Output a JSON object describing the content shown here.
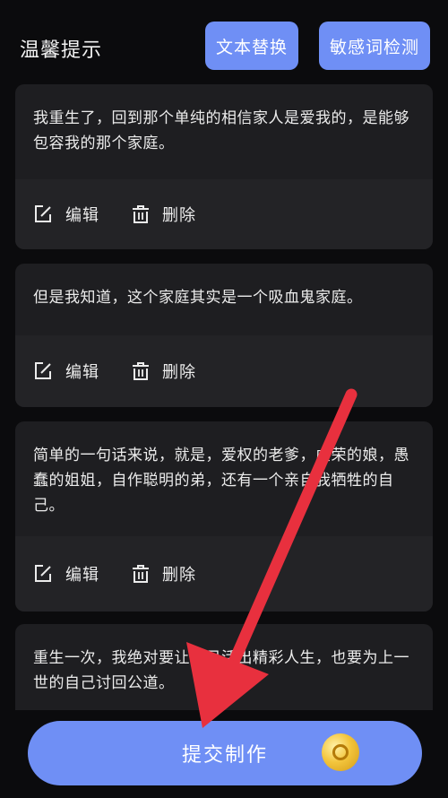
{
  "header": {
    "title": "温馨提示",
    "replace_button": "文本替换",
    "detect_button": "敏感词检测"
  },
  "cards": [
    {
      "text": "我重生了，回到那个单纯的相信家人是爱我的，是能够包容我的那个家庭。",
      "edit": "编辑",
      "delete": "删除"
    },
    {
      "text": "但是我知道，这个家庭其实是一个吸血鬼家庭。",
      "edit": "编辑",
      "delete": "删除"
    },
    {
      "text": "简单的一句话来说，就是，爱权的老爹，虚荣的娘，愚蠢的姐姐，自作聪明的弟，还有一个亲自我牺牲的自己。",
      "edit": "编辑",
      "delete": "删除"
    },
    {
      "text": "重生一次，我绝对要让自己活出精彩人生，也要为上一世的自己讨回公道。"
    }
  ],
  "submit": {
    "label": "提交制作",
    "icon": "coin-icon"
  },
  "colors": {
    "accent": "#6f8ff5",
    "card_bg": "#1e1e21",
    "page_bg": "#0b0b0d",
    "arrow": "#e8303e"
  }
}
